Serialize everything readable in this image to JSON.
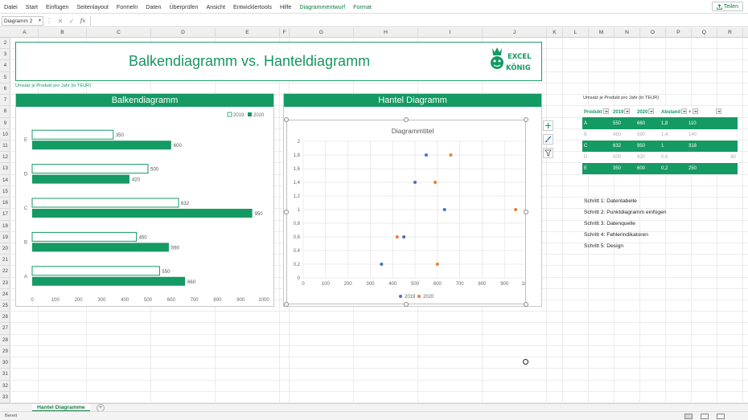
{
  "ribbon": {
    "menus": [
      "Datei",
      "Start",
      "Einfügen",
      "Seitenlayout",
      "Formeln",
      "Daten",
      "Überprüfen",
      "Ansicht",
      "Entwicklertools",
      "Hilfe",
      "Diagrammentwurf",
      "Format"
    ],
    "share_label": "Teilen"
  },
  "formula_bar": {
    "name_box": "Diagramm 2",
    "fx": "fx"
  },
  "columns": [
    "A",
    "B",
    "C",
    "D",
    "E",
    "F",
    "G",
    "H",
    "I",
    "J",
    "K",
    "L",
    "M",
    "N",
    "O",
    "P",
    "Q",
    "R"
  ],
  "rows": [
    "2",
    "3",
    "4",
    "5",
    "6",
    "7",
    "8",
    "9",
    "10",
    "11",
    "12",
    "13",
    "14",
    "15",
    "16",
    "17",
    "18",
    "19",
    "20",
    "21",
    "22",
    "23",
    "24",
    "25",
    "26",
    "27",
    "28",
    "29",
    "30",
    "31",
    "32",
    "33"
  ],
  "sheet": {
    "title": "Balkendiagramm vs. Hanteldiagramm",
    "subtitle": "Umsatz je Produkt pro Jahr (in TEUR)",
    "logo_top": "EXCEL",
    "logo_bottom": "KÖNIG"
  },
  "chart_data": [
    {
      "type": "bar",
      "title": "Balkendiagramm",
      "categories": [
        "E",
        "D",
        "C",
        "B",
        "A"
      ],
      "series": [
        {
          "name": "2019",
          "values": [
            350,
            500,
            632,
            450,
            550
          ]
        },
        {
          "name": "2020",
          "values": [
            600,
            420,
            950,
            590,
            660
          ]
        }
      ],
      "xlim": [
        0,
        1000
      ],
      "xticks": [
        "0",
        "100",
        "200",
        "300",
        "400",
        "500",
        "600",
        "700",
        "800",
        "900",
        "1000"
      ],
      "legend": "top-right",
      "colors": {
        "2019": "#149a63",
        "2020": "#149a63"
      }
    },
    {
      "type": "scatter",
      "title": "Hantel Diagramm",
      "chart_title": "Diagrammtitel",
      "series": [
        {
          "name": "2019",
          "x": [
            350,
            450,
            632,
            500,
            550
          ],
          "y": [
            0.2,
            0.6,
            1.0,
            1.4,
            1.8
          ]
        },
        {
          "name": "2020",
          "x": [
            600,
            420,
            950,
            590,
            660
          ],
          "y": [
            0.2,
            0.6,
            1.0,
            1.4,
            1.8
          ]
        }
      ],
      "xlim": [
        0,
        1000
      ],
      "ylim": [
        0,
        2
      ],
      "xticks": [
        "0",
        "100",
        "200",
        "300",
        "400",
        "500",
        "600",
        "700",
        "800",
        "900",
        "1000"
      ],
      "yticks": [
        "0",
        "0,2",
        "0,4",
        "0,6",
        "0,8",
        "1",
        "1,2",
        "1,4",
        "1,6",
        "1,8",
        "2"
      ],
      "legend": "bottom",
      "colors": {
        "2019": "#4472c4",
        "2020": "#ed7d31"
      }
    }
  ],
  "table": {
    "title": "Umsatz je Produkt pro Jahr (in TEUR)",
    "headers": [
      "Produkt",
      "2019",
      "2020",
      "Abstand",
      "+",
      ""
    ],
    "rows": [
      [
        "A",
        "550",
        "660",
        "1,8",
        "110",
        ""
      ],
      [
        "B",
        "450",
        "590",
        "1,4",
        "140",
        ""
      ],
      [
        "C",
        "632",
        "950",
        "1",
        "318",
        ""
      ],
      [
        "D",
        "500",
        "420",
        "0,6",
        "",
        "80"
      ],
      [
        "E",
        "350",
        "600",
        "0,2",
        "250",
        ""
      ]
    ]
  },
  "steps": [
    "Schritt 1: Datentabelle",
    "Schritt 2: Punktdiagramm einfügen",
    "Schritt 3: Datenquelle",
    "Schritt 4: Fehlerindikatoren",
    "Schritt 5: Design"
  ],
  "sheet_tab": "Hantel Diagramme",
  "status": "Bereit"
}
